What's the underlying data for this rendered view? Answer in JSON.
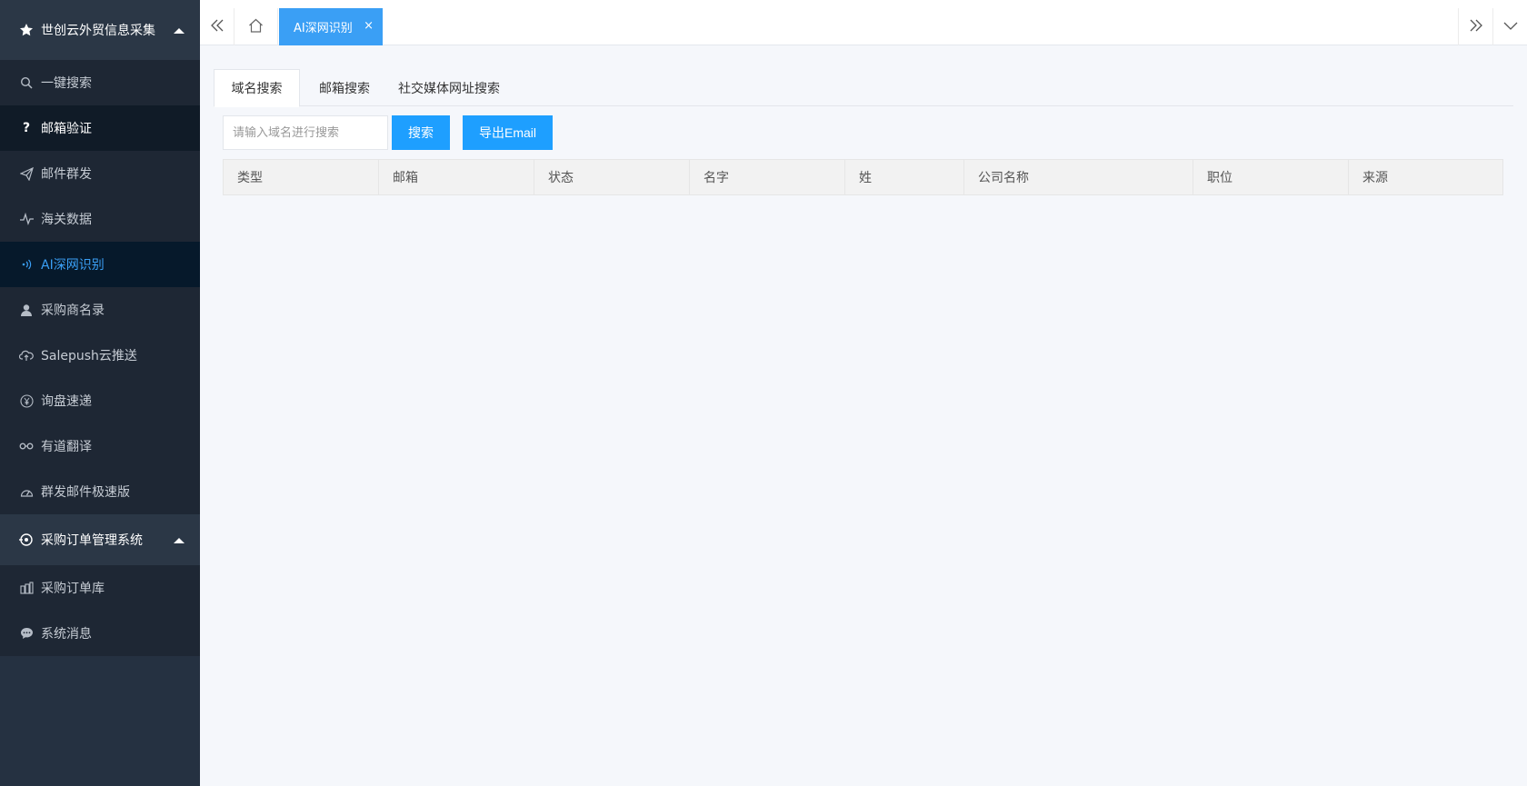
{
  "sidebar": {
    "group1": {
      "title": "世创云外贸信息采集",
      "items": [
        {
          "label": "一键搜索",
          "icon": "search-icon"
        },
        {
          "label": "邮箱验证",
          "icon": "question-icon"
        },
        {
          "label": "邮件群发",
          "icon": "send-icon"
        },
        {
          "label": "海关数据",
          "icon": "pulse-icon"
        },
        {
          "label": "AI深网识别",
          "icon": "signal-icon"
        },
        {
          "label": "采购商名录",
          "icon": "user-icon"
        },
        {
          "label": "Salepush云推送",
          "icon": "cloud-upload-icon"
        },
        {
          "label": "询盘速递",
          "icon": "yen-icon"
        },
        {
          "label": "有道翻译",
          "icon": "link-icon"
        },
        {
          "label": "群发邮件极速版",
          "icon": "gauge-icon"
        }
      ]
    },
    "group2": {
      "title": "采购订单管理系统",
      "items": [
        {
          "label": "采购订单库",
          "icon": "library-icon"
        },
        {
          "label": "系统消息",
          "icon": "chat-icon"
        }
      ]
    }
  },
  "topbar": {
    "active_tab": "AI深网识别",
    "tab_close": "×"
  },
  "content": {
    "tabs": [
      "域名搜索",
      "邮箱搜索",
      "社交媒体网址搜索"
    ],
    "search_placeholder": "请输入域名进行搜索",
    "search_button": "搜索",
    "export_button": "导出Email",
    "table_headers": [
      "类型",
      "邮箱",
      "状态",
      "名字",
      "姓",
      "公司名称",
      "职位",
      "来源"
    ]
  },
  "colors": {
    "sidebar_bg": "#1e2734",
    "active_accent": "#3a9ff5",
    "button_blue": "#1e9fff"
  }
}
